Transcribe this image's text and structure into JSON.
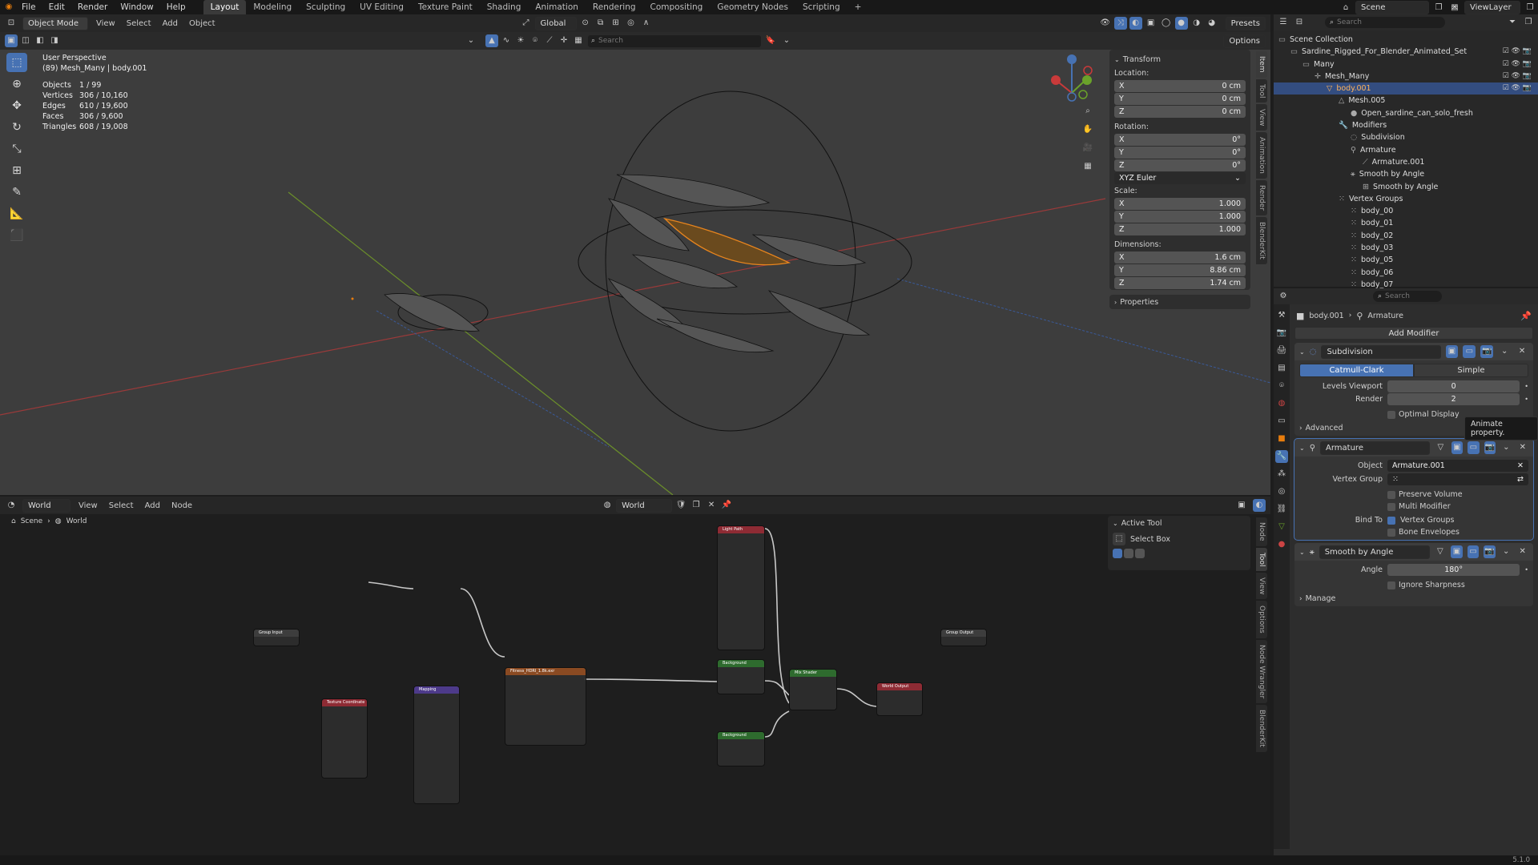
{
  "topbar": {
    "menus": [
      "File",
      "Edit",
      "Render",
      "Window",
      "Help"
    ],
    "workspaces": [
      "Layout",
      "Modeling",
      "Sculpting",
      "UV Editing",
      "Texture Paint",
      "Shading",
      "Animation",
      "Rendering",
      "Compositing",
      "Geometry Nodes",
      "Scripting"
    ],
    "active_workspace": "Layout",
    "scene": "Scene",
    "view_layer": "ViewLayer"
  },
  "viewport": {
    "mode": "Object Mode",
    "menus": [
      "View",
      "Select",
      "Add",
      "Object"
    ],
    "orientation": "Global",
    "options": "Options",
    "presets": "Presets",
    "search_placeholder": "Search",
    "perspective": "User Perspective",
    "object_name": "(89) Mesh_Many | body.001",
    "stats": [
      {
        "label": "Objects",
        "value": "1 / 99"
      },
      {
        "label": "Vertices",
        "value": "306 / 10,160"
      },
      {
        "label": "Edges",
        "value": "610 / 19,600"
      },
      {
        "label": "Faces",
        "value": "306 / 9,600"
      },
      {
        "label": "Triangles",
        "value": "608 / 19,008"
      }
    ],
    "side_tabs": [
      "Item",
      "Tool",
      "View",
      "Animation",
      "Render",
      "BlenderKit"
    ]
  },
  "transform": {
    "title": "Transform",
    "location_label": "Location:",
    "location": [
      {
        "axis": "X",
        "value": "0 cm"
      },
      {
        "axis": "Y",
        "value": "0 cm"
      },
      {
        "axis": "Z",
        "value": "0 cm"
      }
    ],
    "rotation_label": "Rotation:",
    "rotation": [
      {
        "axis": "X",
        "value": "0°"
      },
      {
        "axis": "Y",
        "value": "0°"
      },
      {
        "axis": "Z",
        "value": "0°"
      }
    ],
    "rotation_mode": "XYZ Euler",
    "scale_label": "Scale:",
    "scale": [
      {
        "axis": "X",
        "value": "1.000"
      },
      {
        "axis": "Y",
        "value": "1.000"
      },
      {
        "axis": "Z",
        "value": "1.000"
      }
    ],
    "dimensions_label": "Dimensions:",
    "dimensions": [
      {
        "axis": "X",
        "value": "1.6 cm"
      },
      {
        "axis": "Y",
        "value": "8.86 cm"
      },
      {
        "axis": "Z",
        "value": "1.74 cm"
      }
    ],
    "properties": "Properties"
  },
  "outliner": {
    "search_placeholder": "Search",
    "rows": [
      {
        "label": "Scene Collection",
        "indent": 0,
        "icon": "collection-icon",
        "sel": false
      },
      {
        "label": "Sardine_Rigged_For_Blender_Animated_Set",
        "indent": 1,
        "icon": "collection-icon",
        "sel": false
      },
      {
        "label": "Many",
        "indent": 2,
        "icon": "collection-icon",
        "sel": false
      },
      {
        "label": "Mesh_Many",
        "indent": 3,
        "icon": "empty-icon",
        "sel": false
      },
      {
        "label": "body.001",
        "indent": 4,
        "icon": "mesh-object-icon",
        "sel": true
      },
      {
        "label": "Mesh.005",
        "indent": 5,
        "icon": "mesh-data-icon",
        "sel": false
      },
      {
        "label": "Open_sardine_can_solo_fresh",
        "indent": 6,
        "icon": "material-icon",
        "sel": false
      },
      {
        "label": "Modifiers",
        "indent": 5,
        "icon": "wrench-icon",
        "sel": false
      },
      {
        "label": "Subdivision",
        "indent": 6,
        "icon": "modifier-icon",
        "sel": false
      },
      {
        "label": "Armature",
        "indent": 6,
        "icon": "armature-modifier-icon",
        "sel": false
      },
      {
        "label": "Armature.001",
        "indent": 7,
        "icon": "armature-icon",
        "sel": false
      },
      {
        "label": "Smooth by Angle",
        "indent": 6,
        "icon": "geometry-nodes-icon",
        "sel": false
      },
      {
        "label": "Smooth by Angle",
        "indent": 7,
        "icon": "node-tree-icon",
        "sel": false
      },
      {
        "label": "Vertex Groups",
        "indent": 5,
        "icon": "vertex-group-icon",
        "sel": false
      },
      {
        "label": "body_00",
        "indent": 6,
        "icon": "vertex-group-icon",
        "sel": false
      },
      {
        "label": "body_01",
        "indent": 6,
        "icon": "vertex-group-icon",
        "sel": false
      },
      {
        "label": "body_02",
        "indent": 6,
        "icon": "vertex-group-icon",
        "sel": false
      },
      {
        "label": "body_03",
        "indent": 6,
        "icon": "vertex-group-icon",
        "sel": false
      },
      {
        "label": "body_05",
        "indent": 6,
        "icon": "vertex-group-icon",
        "sel": false
      },
      {
        "label": "body_06",
        "indent": 6,
        "icon": "vertex-group-icon",
        "sel": false
      },
      {
        "label": "body_07",
        "indent": 6,
        "icon": "vertex-group-icon",
        "sel": false
      }
    ]
  },
  "properties": {
    "search_placeholder": "Search",
    "breadcrumb_object": "body.001",
    "breadcrumb_modifier": "Armature",
    "add_modifier": "Add Modifier",
    "subdivision": {
      "name": "Subdivision",
      "mode_a": "Catmull-Clark",
      "mode_b": "Simple",
      "levels_viewport_label": "Levels Viewport",
      "levels_viewport": "0",
      "render_label": "Render",
      "render": "2",
      "optimal_display": "Optimal Display",
      "advanced": "Advanced",
      "tooltip": "Animate property."
    },
    "armature": {
      "name": "Armature",
      "object_label": "Object",
      "object_value": "Armature.001",
      "vertex_group_label": "Vertex Group",
      "preserve_volume": "Preserve Volume",
      "multi_modifier": "Multi Modifier",
      "bind_to_label": "Bind To",
      "vertex_groups": "Vertex Groups",
      "bone_envelopes": "Bone Envelopes"
    },
    "smooth": {
      "name": "Smooth by Angle",
      "angle_label": "Angle",
      "angle_value": "180°",
      "ignore_sharpness": "Ignore Sharpness",
      "manage": "Manage"
    }
  },
  "node_editor": {
    "world_type": "World",
    "menus": [
      "View",
      "Select",
      "Add",
      "Node"
    ],
    "world_name": "World",
    "breadcrumb_scene": "Scene",
    "breadcrumb_world": "World",
    "active_tool": "Active Tool",
    "select_box": "Select Box",
    "side_tabs": [
      "Node",
      "Tool",
      "View",
      "Options",
      "Node Wrangler",
      "BlenderKit"
    ],
    "nodes": {
      "group_input": "Group Input",
      "group_output": "Group Output",
      "texcoord": "Texture Coordinate",
      "mapping": "Mapping",
      "env": "Fitness_HDRI_1.8k.exr",
      "lightpath": "Light Path",
      "bg1": "Background",
      "bg2": "Background",
      "mix": "Mix Shader",
      "output": "World Output"
    }
  },
  "statusbar": {
    "version": "5.1.0"
  }
}
